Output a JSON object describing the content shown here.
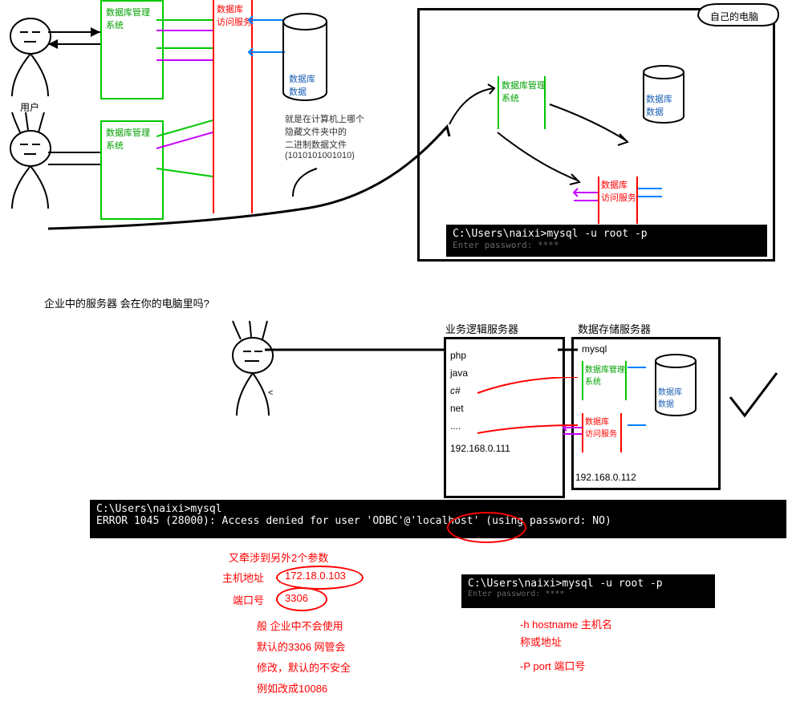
{
  "top": {
    "user_label": "用户",
    "dbms1": "数据库管理\n系统",
    "dbms2": "数据库管理\n系统",
    "access_service": "数据库\n访问服务",
    "database": "数据库\n数据",
    "data_desc": "就是在计算机上哪个\n隐藏文件夹中的\n二进制数据文件\n(1010101001010)",
    "computer_label": "自己的电脑",
    "right_dbms": "数据库管理\n系统",
    "right_db": "数据库\n数据",
    "right_access": "数据库\n访问服务",
    "terminal1": "C:\\Users\\naixi>mysql -u root -p",
    "terminal1_pwd": "Enter password: ****"
  },
  "question": "企业中的服务器 会在你的电脑里吗?",
  "mid": {
    "logic_server_label": "业务逻辑服务器",
    "storage_server_label": "数据存储服务器",
    "logic_langs": [
      "php",
      "java",
      "c#",
      "net",
      "...."
    ],
    "logic_ip": "192.168.0.111",
    "storage_ip": "192.168.0.112",
    "storage_mysql": "mysql",
    "storage_dbms": "数据库管理\n系统",
    "storage_access": "数据库\n访问服务",
    "storage_db": "数据库\n数据"
  },
  "terminal_error_line1": "C:\\Users\\naixi>mysql",
  "terminal_error_line2": "ERROR 1045 (28000): Access denied for user 'ODBC'@'localhost' (using password: NO)",
  "annotations": {
    "extra_params": "又牵涉到另外2个参数",
    "host_label": "主机地址",
    "host_value": "172.18.0.103",
    "port_label": "端口号",
    "port_value": "3306",
    "port_note": "般 企业中不会使用\n默认的3306 网管会\n修改，默认的不安全\n例如改成10086",
    "h_option": "-h hostname 主机名\n称或地址",
    "p_option": "-P port 端口号"
  },
  "terminal2": "C:\\Users\\naixi>mysql -u root -p",
  "terminal2_pwd": "Enter password: ****"
}
